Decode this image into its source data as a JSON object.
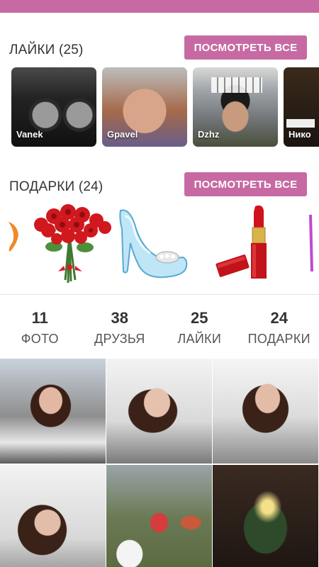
{
  "theme": {
    "accent": "#c76aa3",
    "text": "#333333"
  },
  "likes": {
    "title": "ЛАЙКИ (25)",
    "see_all_label": "ПОСМОТРЕТЬ ВСЕ",
    "users": [
      {
        "name": "Vanek"
      },
      {
        "name": "Gpavel"
      },
      {
        "name": "Dzhz"
      },
      {
        "name": "Нико"
      }
    ]
  },
  "gifts": {
    "title": "ПОДАРКИ (24)",
    "see_all_label": "ПОСМОТРЕТЬ ВСЕ",
    "items": [
      {
        "icon": "partial-gift-icon"
      },
      {
        "icon": "roses-bouquet-icon"
      },
      {
        "icon": "glass-slipper-icon"
      },
      {
        "icon": "lipstick-icon"
      },
      {
        "icon": "partial-gift-icon"
      }
    ]
  },
  "stats": [
    {
      "value": "11",
      "label": "ФОТО"
    },
    {
      "value": "38",
      "label": "ДРУЗЬЯ"
    },
    {
      "value": "25",
      "label": "ЛАЙКИ"
    },
    {
      "value": "24",
      "label": "ПОДАРКИ"
    }
  ]
}
